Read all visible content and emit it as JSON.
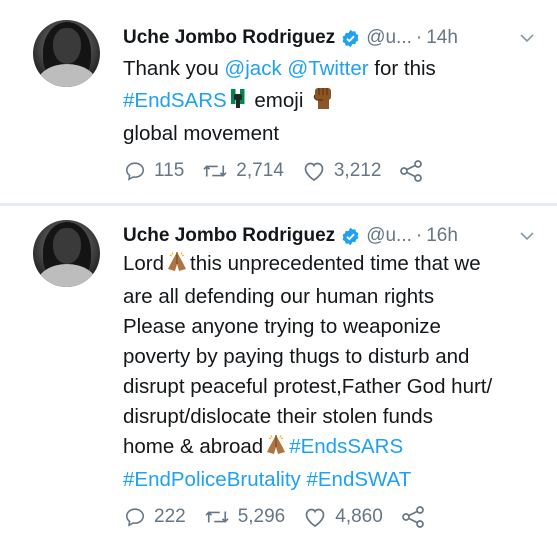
{
  "tweets": [
    {
      "author_name": "Uche Jombo Rodriguez",
      "handle": "@u...",
      "dot": "·",
      "time": "14h",
      "lines": [
        [
          {
            "t": "Thank you "
          },
          {
            "t": "@jack",
            "link": true
          },
          {
            "t": " "
          },
          {
            "t": "@Twitter",
            "link": true
          },
          {
            "t": " for this"
          }
        ],
        [
          {
            "t": "#EndSARS",
            "link": true
          },
          {
            "emoji": "flag-fist-emoji"
          },
          {
            "t": " emoji "
          },
          {
            "emoji": "raised-fist-emoji"
          }
        ],
        [
          {
            "t": "global movement"
          }
        ]
      ],
      "replies": "115",
      "retweets": "2,714",
      "likes": "3,212"
    },
    {
      "author_name": "Uche Jombo Rodriguez",
      "handle": "@u...",
      "dot": "·",
      "time": "16h",
      "lines": [
        [
          {
            "t": "Lord"
          },
          {
            "emoji": "praying-hands-emoji"
          },
          {
            "t": "this unprecedented time that we"
          }
        ],
        [
          {
            "t": "are all defending our human rights"
          }
        ],
        [
          {
            "t": "Please anyone trying to weaponize"
          }
        ],
        [
          {
            "t": "poverty by paying thugs to disturb and"
          }
        ],
        [
          {
            "t": "disrupt peaceful protest,Father God hurt/"
          }
        ],
        [
          {
            "t": "disrupt/dislocate their stolen funds"
          }
        ],
        [
          {
            "t": "home & abroad"
          },
          {
            "emoji": "praying-hands-emoji"
          },
          {
            "t": "#EndsSARS",
            "link": true
          }
        ],
        [
          {
            "t": "#EndPoliceBrutality",
            "link": true
          },
          {
            "t": " "
          },
          {
            "t": "#EndSWAT",
            "link": true
          }
        ]
      ],
      "replies": "222",
      "retweets": "5,296",
      "likes": "4,860"
    }
  ],
  "colors": {
    "text": "#14171a",
    "secondary": "#657786",
    "link": "#1da1f2",
    "verified": "#1da1f2",
    "divider": "#e6ecf0"
  }
}
